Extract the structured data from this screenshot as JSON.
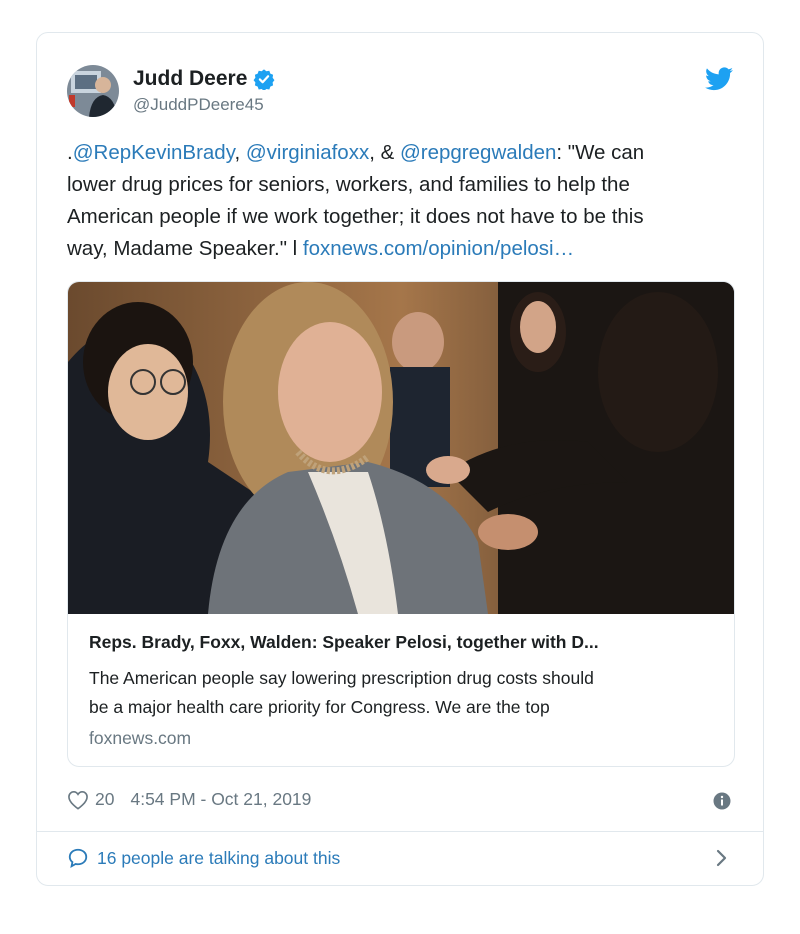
{
  "tweet": {
    "author_name": "Judd Deere",
    "author_handle": "@JuddPDeere45",
    "text_line1_prefix": ".",
    "mention1": "@RepKevinBrady",
    "text_sep1": ", ",
    "mention2": "@virginiafoxx",
    "text_sep2": ", & ",
    "mention3": "@repgregwalden",
    "text_line1_suffix": ": \"We can",
    "text_line2": "lower drug prices for seniors, workers, and families to help the",
    "text_line3": "American people if we work together; it does not have to be this",
    "text_line4_prefix": "way, Madame Speaker.\" l ",
    "link": "foxnews.com/opinion/pelosi…"
  },
  "card": {
    "title": "Reps. Brady, Foxx, Walden: Speaker Pelosi, together with D...",
    "desc_line1": "The American people say lowering prescription drug costs should",
    "desc_line2": "be a major health care priority for Congress. We are the top",
    "domain": "foxnews.com"
  },
  "meta": {
    "likes": "20",
    "timestamp": "4:54 PM - Oct 21, 2019"
  },
  "footer": {
    "talking": "16 people are talking about this"
  },
  "colors": {
    "link": "#2b7bb9",
    "verified": "#1da1f2",
    "muted": "#697882"
  },
  "icons": [
    "avatar",
    "verified-badge-icon",
    "twitter-bird-icon",
    "heart-icon",
    "info-icon",
    "chat-bubble-icon",
    "chevron-right-icon"
  ]
}
